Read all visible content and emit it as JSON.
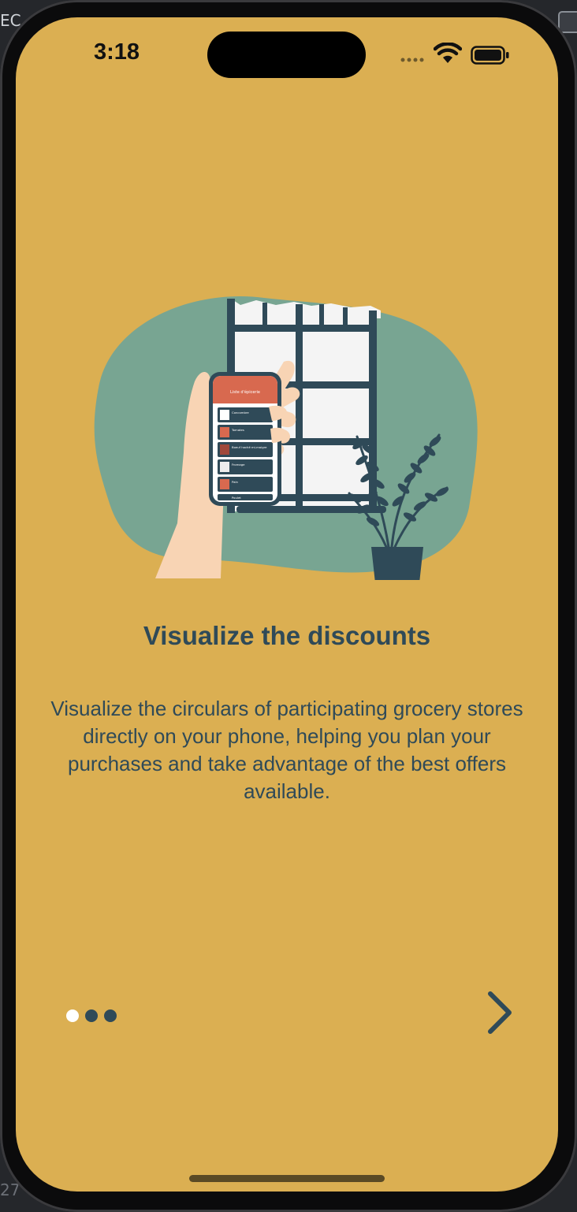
{
  "status_bar": {
    "time": "3:18"
  },
  "onboarding": {
    "title": "Visualize the discounts",
    "description": "Visualize the circulars of participating grocery stores directly on your phone, helping you plan your purchases and take advantage of the best offers available.",
    "page_count": 3,
    "current_page": 1
  },
  "illustration": {
    "phone_header": "Liste d'épicerie",
    "phone_items": [
      "Concombre",
      "Tomates",
      "Boeuf haché mi-maigre",
      "Fromage",
      "Pain",
      "Poulet"
    ]
  },
  "editor": {
    "corner_top_left": "EC",
    "corner_bottom_left": "27"
  },
  "colors": {
    "background": "#DBAF52",
    "text": "#2F4A58",
    "accent": "#D8694F",
    "blob": "#78A592",
    "active_dot": "#FFFFFF"
  },
  "icons": {
    "wifi": "wifi-icon",
    "battery": "battery-icon",
    "next": "chevron-right-icon"
  }
}
